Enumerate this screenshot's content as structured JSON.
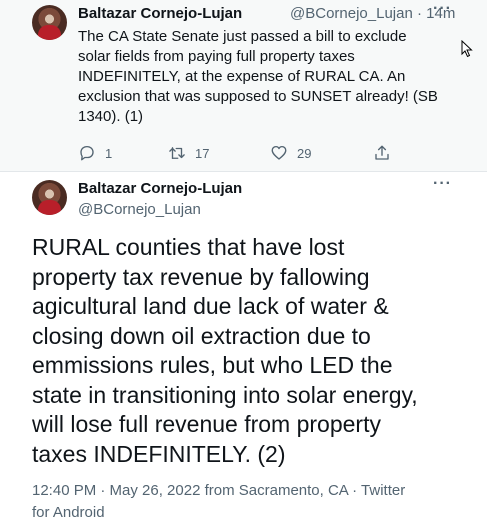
{
  "tweet1": {
    "author_name": "Baltazar Cornejo-Lujan",
    "author_handle_time": "@BCornejo_Lujan · 14m",
    "text": "The CA State Senate just passed a bill to exclude\nsolar fields from paying full property taxes\nINDEFINITELY, at the expense of RURAL CA. An\nexclusion that was supposed to SUNSET already! (SB\n1340). (1)",
    "replies": "1",
    "retweets": "17",
    "likes": "29",
    "more": "···",
    "icons": [
      "reply-icon",
      "retweet-icon",
      "like-icon",
      "share-icon",
      "more-icon"
    ]
  },
  "tweet2": {
    "author_name": "Baltazar Cornejo-Lujan",
    "author_handle": "@BCornejo_Lujan",
    "more": "···",
    "text": "RURAL counties that have lost\nproperty tax revenue by fallowing\nagicultural land due lack of water &\nclosing down oil extraction due to\nemmissions rules, but who LED the\nstate in transitioning into solar energy,\nwill lose full revenue from property\ntaxes INDEFINITELY. (2)",
    "meta": "12:40 PM · May 26, 2022 from Sacramento, CA · Twitter\nfor Android"
  },
  "colors": {
    "text": "#0f1419",
    "secondary": "#536471",
    "highlight_bg": "#f7f9f9"
  }
}
